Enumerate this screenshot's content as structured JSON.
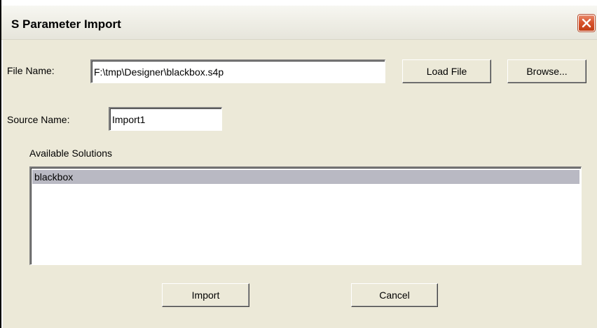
{
  "dialog": {
    "title": "S Parameter Import",
    "close_icon": "close-icon"
  },
  "file": {
    "label": "File Name:",
    "value": "F:\\tmp\\Designer\\blackbox.s4p",
    "load_button": "Load File",
    "browse_button": "Browse..."
  },
  "source": {
    "label": "Source Name:",
    "value": "Import1"
  },
  "solutions": {
    "label": "Available Solutions",
    "items": [
      "blackbox"
    ],
    "selected_index": 0
  },
  "actions": {
    "import": "Import",
    "cancel": "Cancel"
  },
  "colors": {
    "dialog_bg": "#ece9d8",
    "selection": "#b9b9c3",
    "close_button": "#d8542e"
  }
}
